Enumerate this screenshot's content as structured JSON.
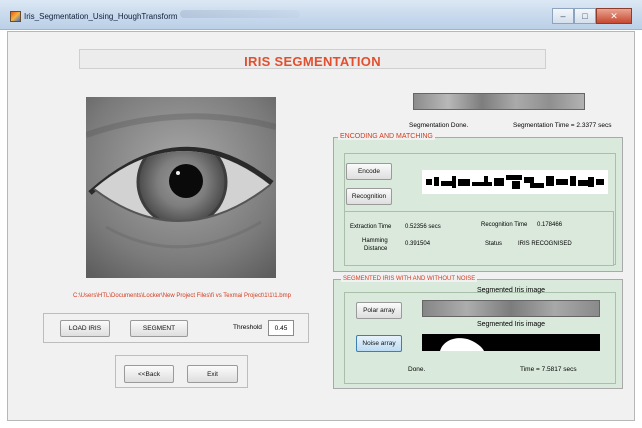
{
  "window": {
    "title": "Iris_Segmentation_Using_HoughTransform",
    "controls": {
      "minimize": "–",
      "maximize": "□",
      "close": "✕"
    }
  },
  "header": {
    "title": "IRIS SEGMENTATION"
  },
  "left": {
    "file_path": "C:\\Users\\HTL\\Documents\\Locker\\New Project Files\\fi vs Texmai Project\\1\\1\\1.bmp",
    "load_button": "LOAD IRIS",
    "segment_button": "SEGMENT",
    "threshold_label": "Threshold",
    "threshold_value": "0.45",
    "back_button": "<<Back",
    "exit_button": "Exit"
  },
  "segmentation": {
    "status": "Segmentation Done.",
    "time": "Segmentation Time = 2.3377 secs"
  },
  "encoding": {
    "panel_title": "ENCODING AND MATCHING",
    "encode_button": "Encode",
    "recognition_button": "Recognition",
    "extraction_time_label": "Extraction Time",
    "extraction_time_value": "0.52356 secs",
    "recognition_time_label": "Recognition Time",
    "recognition_time_value": "0.178466",
    "hamming_label_1": "Hamming",
    "hamming_label_2": "Distance",
    "hamming_value": "0.391504",
    "status_label": "Status",
    "status_value": "IRIS RECOGNISED"
  },
  "segmented": {
    "panel_title": "SEGMENTED IRIS WITH AND WITHOUT NOISE",
    "label_top": "Segmented Iris image",
    "label_bottom": "Segmented Iris image",
    "polar_button": "Polar array",
    "noise_button": "Noise array",
    "done": "Done.",
    "time": "Time = 7.5817 secs"
  },
  "colors": {
    "title_red": "#e24f2e",
    "panel_green": "#d9eadc",
    "label_red": "#d23b1f"
  }
}
